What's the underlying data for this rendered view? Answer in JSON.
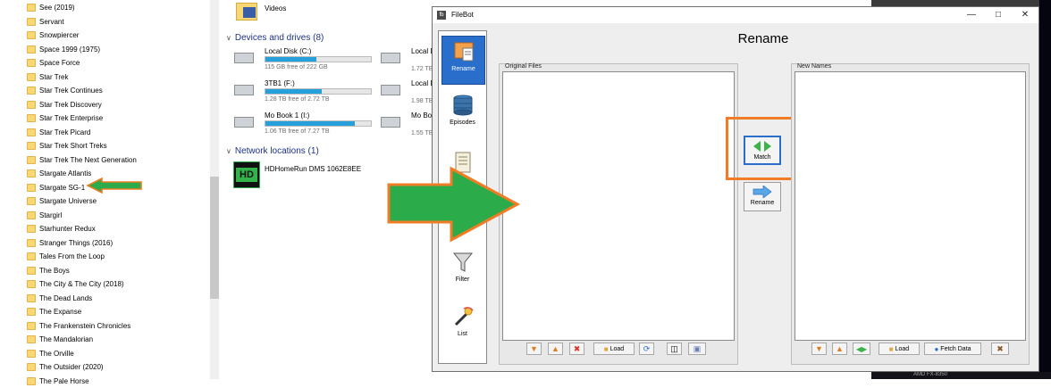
{
  "explorer": {
    "folders": [
      "See (2019)",
      "Servant",
      "Snowpiercer",
      "Space 1999 (1975)",
      "Space Force",
      "Star Trek",
      "Star Trek Continues",
      "Star Trek Discovery",
      "Star Trek Enterprise",
      "Star Trek Picard",
      "Star Trek Short Treks",
      "Star Trek The Next Generation",
      "Stargate Atlantis",
      "Stargate SG-1",
      "Stargate Universe",
      "Stargirl",
      "Starhunter Redux",
      "Stranger Things (2016)",
      "Tales From the Loop",
      "The Boys",
      "The City & The City (2018)",
      "The Dead Lands",
      "The Expanse",
      "The Frankenstein Chronicles",
      "The Mandalorian",
      "The Orville",
      "The Outsider (2020)"
    ],
    "partial_bottom_folder": "The Pale Horse",
    "videos_label": "Videos",
    "devices_header": "Devices and drives (8)",
    "drives": [
      {
        "name": "Local Disk (C:)",
        "free": "115 GB free of 222 GB",
        "used_fraction": 0.48
      },
      {
        "name": "3TB1 (F:)",
        "free": "1.28 TB free of 2.72 TB",
        "used_fraction": 0.53
      },
      {
        "name": "Mo Book 1 (I:)",
        "free": "1.06 TB free of 7.27 TB",
        "used_fraction": 0.85
      }
    ],
    "drives_col2": [
      {
        "name": "Local D",
        "free": "1.72 TB"
      },
      {
        "name": "Local D",
        "free": "1.98 TB"
      },
      {
        "name": "Mo Book",
        "free": "1.55 TB"
      }
    ],
    "network_header": "Network locations (1)",
    "network_device": "HDHomeRun DMS 1062E8EE",
    "network_icon_text": "HD"
  },
  "filebot": {
    "window_title": "FileBot",
    "heading": "Rename",
    "sidebar": [
      "Rename",
      "Episodes",
      "Filter",
      "List"
    ],
    "left_panel_title": "Original Files",
    "right_panel_title": "New Names",
    "match_label": "Match",
    "rename_label": "Rename",
    "load_label": "Load",
    "fetch_label": "Fetch Data"
  },
  "background": {
    "bottom_text": "AMD FX-8350"
  },
  "colors": {
    "accent_orange": "#f07d25",
    "annotation_green": "#2bab4a",
    "drive_bar": "#26a0da",
    "folder_yellow": "#f8d775",
    "selected_blue": "#2a6ecb"
  }
}
